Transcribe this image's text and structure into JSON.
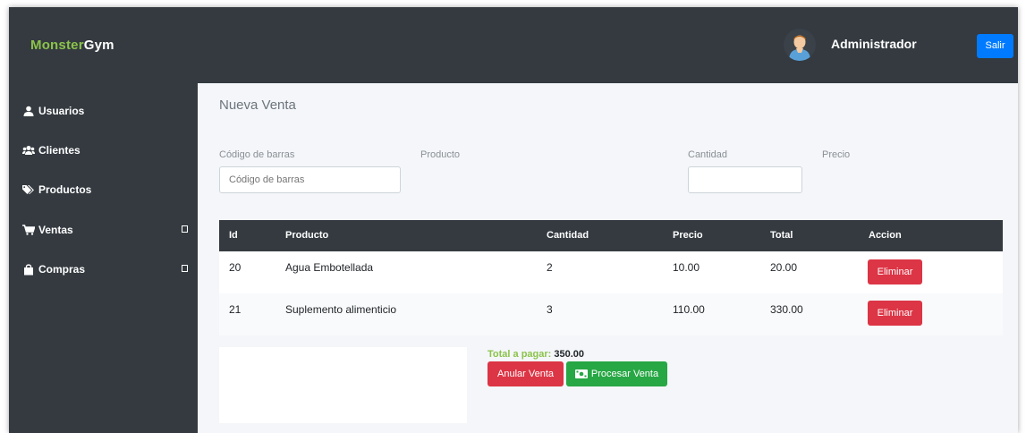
{
  "brand": {
    "part1": "Monster",
    "part2": "Gym"
  },
  "header": {
    "user_name": "Administrador",
    "logout_label": "Salir"
  },
  "sidebar": {
    "items": [
      {
        "label": "Usuarios",
        "icon": "user-icon",
        "has_submenu": false
      },
      {
        "label": "Clientes",
        "icon": "users-icon",
        "has_submenu": false
      },
      {
        "label": "Productos",
        "icon": "tags-icon",
        "has_submenu": false
      },
      {
        "label": "Ventas",
        "icon": "cart-icon",
        "has_submenu": true
      },
      {
        "label": "Compras",
        "icon": "bag-icon",
        "has_submenu": true
      }
    ]
  },
  "page": {
    "title": "Nueva Venta"
  },
  "form": {
    "barcode": {
      "label": "Código de barras",
      "placeholder": "Código de barras",
      "value": ""
    },
    "product": {
      "label": "Producto",
      "value": ""
    },
    "quantity": {
      "label": "Cantidad",
      "value": ""
    },
    "price": {
      "label": "Precio",
      "value": ""
    }
  },
  "table": {
    "columns": [
      "Id",
      "Producto",
      "Cantidad",
      "Precio",
      "Total",
      "Accion"
    ],
    "rows": [
      {
        "id": "20",
        "product": "Agua Embotellada",
        "quantity": "2",
        "price": "10.00",
        "total": "20.00",
        "action": "Eliminar"
      },
      {
        "id": "21",
        "product": "Suplemento alimenticio",
        "quantity": "3",
        "price": "110.00",
        "total": "330.00",
        "action": "Eliminar"
      }
    ]
  },
  "summary": {
    "total_label": "Total a pagar:",
    "total_value": "350.00",
    "cancel_label": "Anular Venta",
    "process_label": "Procesar Venta"
  },
  "colors": {
    "dark": "#343a40",
    "brand_green": "#8bc34a",
    "primary": "#007bff",
    "danger": "#dc3545",
    "success": "#28a745"
  }
}
